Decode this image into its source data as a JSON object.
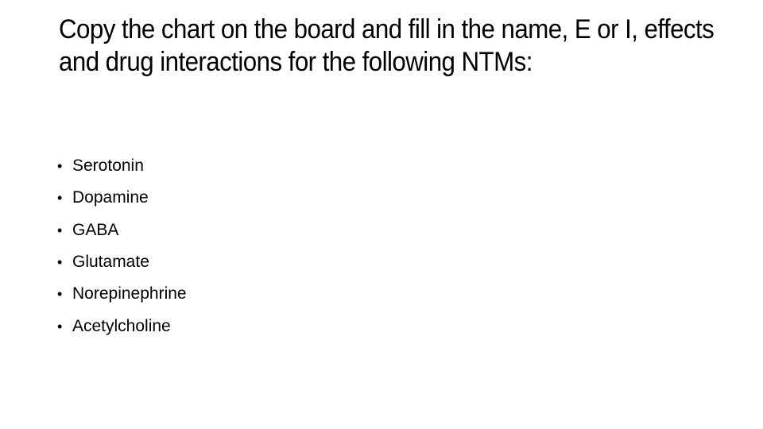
{
  "slide": {
    "title": "Copy the chart on the board and fill in the name, E or I, effects and drug interactions for the following NTMs:",
    "bullet_glyph": "•",
    "items": [
      {
        "label": "Serotonin"
      },
      {
        "label": "Dopamine"
      },
      {
        "label": "GABA"
      },
      {
        "label": "Glutamate"
      },
      {
        "label": "Norepinephrine"
      },
      {
        "label": "Acetylcholine"
      }
    ]
  }
}
